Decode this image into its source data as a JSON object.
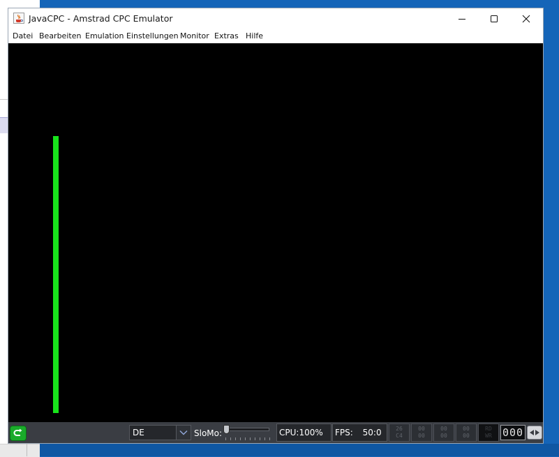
{
  "window": {
    "title": "JavaCPC - Amstrad CPC Emulator",
    "app_icon": "java-cup-icon",
    "controls": [
      "minimize-icon",
      "maximize-icon",
      "close-icon"
    ]
  },
  "menu": [
    {
      "label": "Datei"
    },
    {
      "label": "Bearbeiten"
    },
    {
      "label": "Emulation"
    },
    {
      "label": "Einstellungen"
    },
    {
      "label": "Monitor"
    },
    {
      "label": "Extras"
    },
    {
      "label": "Hilfe"
    }
  ],
  "screen": {
    "background": "#000000",
    "bar_color": "#18e41b"
  },
  "statusbar": {
    "reset_icon": "reset-arrow-icon",
    "keyboard_layout": "DE",
    "slomo_label": "SloMo:",
    "slomo_value": 0,
    "cpu_text": "CPU:100%",
    "fps_label": "FPS:",
    "fps_value": "50:0",
    "leds": [
      {
        "top": "26",
        "bottom": "C4"
      },
      {
        "top": "00",
        "bottom": "00"
      },
      {
        "top": "00",
        "bottom": "00"
      },
      {
        "top": "00",
        "bottom": "00"
      },
      {
        "top": "RD",
        "bottom": "WR"
      }
    ],
    "tape_counter": "000",
    "tape_icon": "tape-play-icon"
  },
  "colors": {
    "statusbar_bg": "#3a3d43",
    "accent_green": "#18e41b",
    "desktop_blue": "#1565b8"
  }
}
